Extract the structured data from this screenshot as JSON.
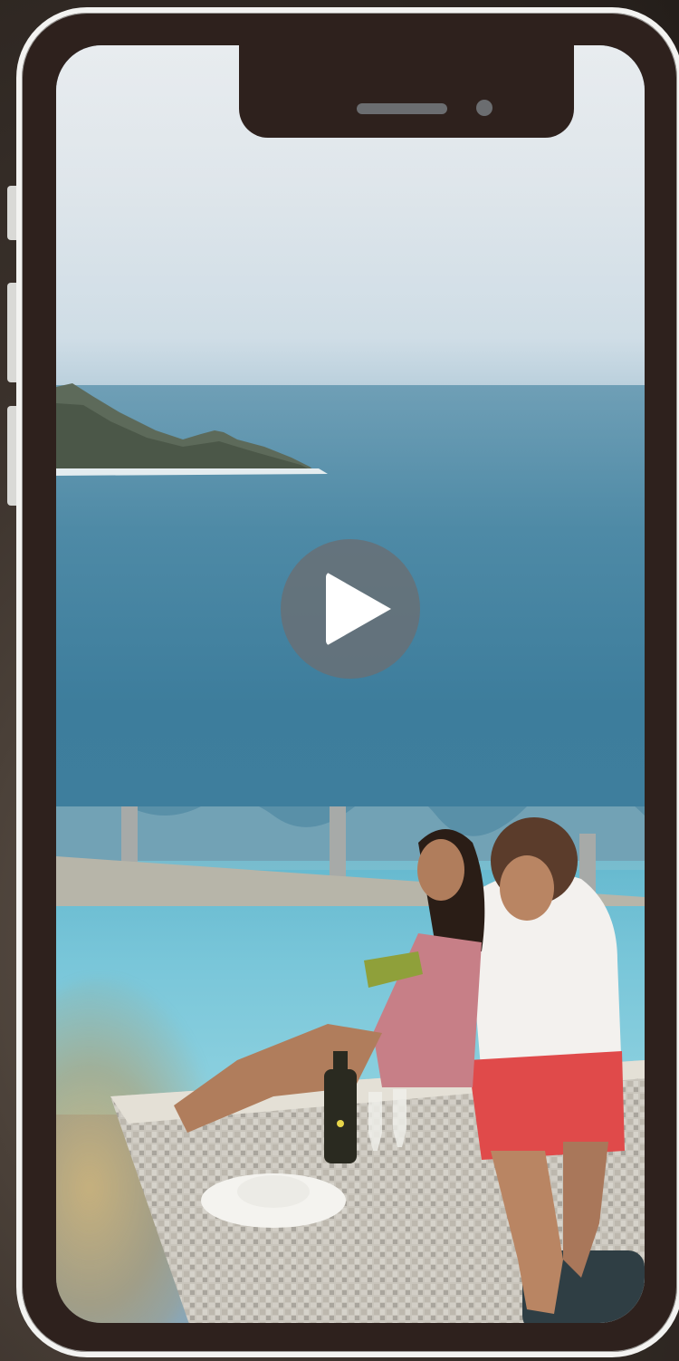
{
  "video": {
    "state": "paused",
    "play_icon": "play-icon"
  },
  "colors": {
    "frame": "#2e211d",
    "frame_border": "#f3f3f1",
    "play_overlay": "#697076",
    "play_glyph": "#ffffff"
  }
}
